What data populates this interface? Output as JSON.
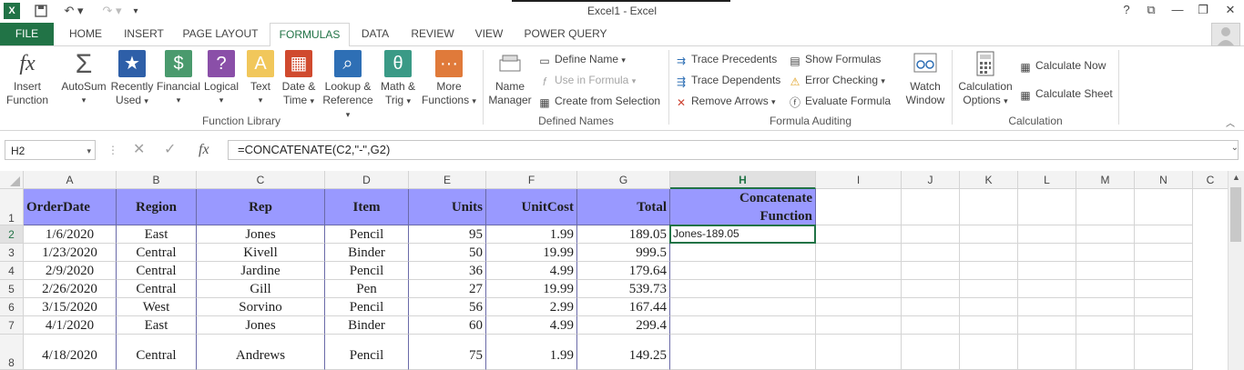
{
  "title_bar": {
    "title": "Excel1 - Excel",
    "help": "?",
    "ribbon_opts": "⧉",
    "minimize": "—",
    "restore": "❐",
    "close": "✕"
  },
  "tabs": [
    "FILE",
    "HOME",
    "INSERT",
    "PAGE LAYOUT",
    "FORMULAS",
    "DATA",
    "REVIEW",
    "VIEW",
    "POWER QUERY"
  ],
  "ribbon": {
    "function_library": {
      "label": "Function Library",
      "insert_function": [
        "Insert",
        "Function"
      ],
      "autosum": "AutoSum",
      "recently_used": [
        "Recently",
        "Used"
      ],
      "financial": "Financial",
      "logical": "Logical",
      "text": "Text",
      "date_time": [
        "Date &",
        "Time"
      ],
      "lookup_reference": [
        "Lookup &",
        "Reference"
      ],
      "math_trig": [
        "Math &",
        "Trig"
      ],
      "more_functions": [
        "More",
        "Functions"
      ]
    },
    "defined_names": {
      "label": "Defined Names",
      "name_manager": [
        "Name",
        "Manager"
      ],
      "define_name": "Define Name",
      "use_in_formula": "Use in Formula",
      "create_from_selection": "Create from Selection"
    },
    "formula_auditing": {
      "label": "Formula Auditing",
      "trace_precedents": "Trace Precedents",
      "trace_dependents": "Trace Dependents",
      "remove_arrows": "Remove Arrows",
      "show_formulas": "Show Formulas",
      "error_checking": "Error Checking",
      "evaluate_formula": "Evaluate Formula",
      "watch_window": [
        "Watch",
        "Window"
      ]
    },
    "calculation": {
      "label": "Calculation",
      "calculation_options": [
        "Calculation",
        "Options"
      ],
      "calculate_now": "Calculate Now",
      "calculate_sheet": "Calculate Sheet"
    }
  },
  "formula_bar": {
    "name_box": "H2",
    "formula": "=CONCATENATE(C2,\"-\",G2)"
  },
  "columns": [
    "A",
    "B",
    "C",
    "D",
    "E",
    "F",
    "G",
    "H",
    "I",
    "J",
    "K",
    "L",
    "M",
    "N",
    "C"
  ],
  "row_numbers": [
    "1",
    "2",
    "3",
    "4",
    "5",
    "6",
    "7",
    "8"
  ],
  "headers": [
    "OrderDate",
    "Region",
    "Rep",
    "Item",
    "Units",
    "UnitCost",
    "Total"
  ],
  "concat_header": [
    "Concatenate",
    "Function"
  ],
  "rows": [
    [
      "1/6/2020",
      "East",
      "Jones",
      "Pencil",
      "95",
      "1.99",
      "189.05"
    ],
    [
      "1/23/2020",
      "Central",
      "Kivell",
      "Binder",
      "50",
      "19.99",
      "999.5"
    ],
    [
      "2/9/2020",
      "Central",
      "Jardine",
      "Pencil",
      "36",
      "4.99",
      "179.64"
    ],
    [
      "2/26/2020",
      "Central",
      "Gill",
      "Pen",
      "27",
      "19.99",
      "539.73"
    ],
    [
      "3/15/2020",
      "West",
      "Sorvino",
      "Pencil",
      "56",
      "2.99",
      "167.44"
    ],
    [
      "4/1/2020",
      "East",
      "Jones",
      "Binder",
      "60",
      "4.99",
      "299.4"
    ],
    [
      "4/18/2020",
      "Central",
      "Andrews",
      "Pencil",
      "75",
      "1.99",
      "149.25"
    ]
  ],
  "h2_value": "Jones-189.05",
  "colors": {
    "excel_green": "#217346",
    "header_fill": "#9999ff"
  }
}
